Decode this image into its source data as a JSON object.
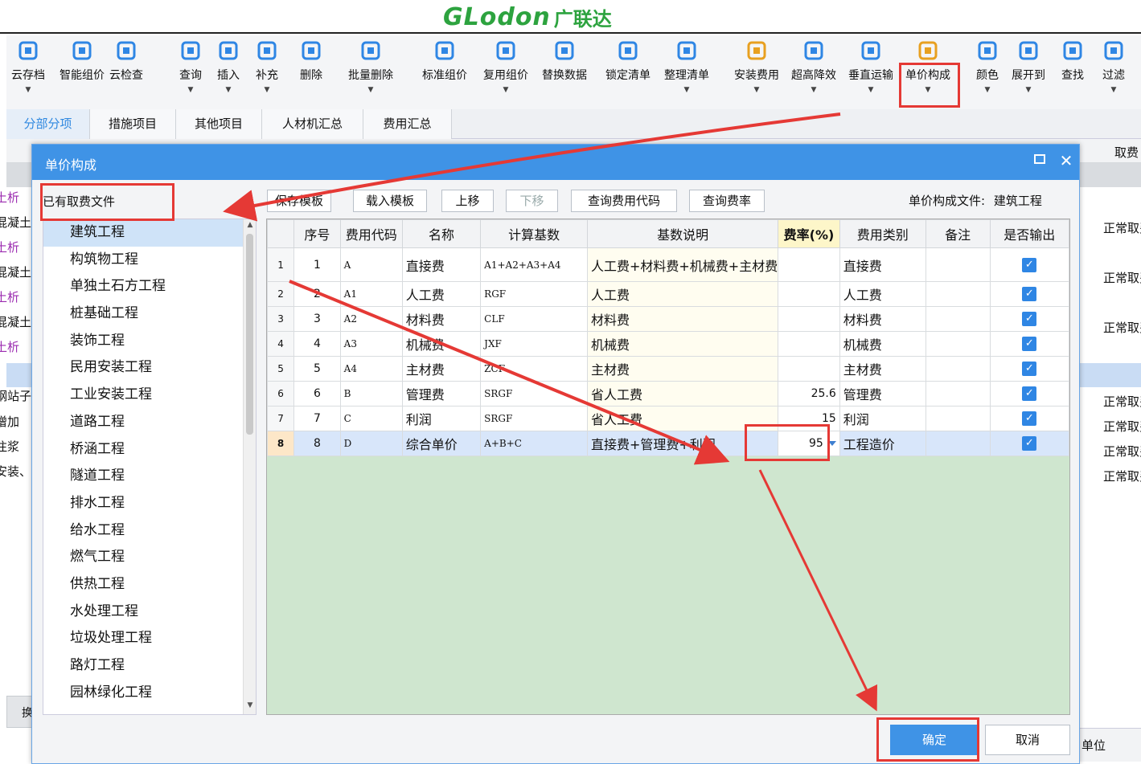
{
  "logo": {
    "en": "GLodon",
    "cn": "广联达"
  },
  "toolbar": [
    {
      "label": "云存档",
      "icon": "cloud-save-icon",
      "arrow": true
    },
    {
      "label": "智能组价",
      "icon": "smart-price-icon",
      "arrow": false
    },
    {
      "label": "云检查",
      "icon": "cloud-check-icon",
      "arrow": false
    },
    {
      "label": "查询",
      "icon": "query-icon",
      "arrow": true
    },
    {
      "label": "插入",
      "icon": "insert-icon",
      "arrow": true
    },
    {
      "label": "补充",
      "icon": "supplement-icon",
      "arrow": true
    },
    {
      "label": "删除",
      "icon": "delete-icon",
      "arrow": false
    },
    {
      "label": "批量删除",
      "icon": "batch-delete-icon",
      "arrow": true
    },
    {
      "label": "标准组价",
      "icon": "standard-price-icon",
      "arrow": false
    },
    {
      "label": "复用组价",
      "icon": "reuse-price-icon",
      "arrow": true
    },
    {
      "label": "替换数据",
      "icon": "replace-data-icon",
      "arrow": false
    },
    {
      "label": "锁定清单",
      "icon": "lock-list-icon",
      "arrow": false
    },
    {
      "label": "整理清单",
      "icon": "organize-list-icon",
      "arrow": true
    },
    {
      "label": "安装费用",
      "icon": "install-cost-icon",
      "arrow": true
    },
    {
      "label": "超高降效",
      "icon": "high-rise-icon",
      "arrow": true
    },
    {
      "label": "垂直运输",
      "icon": "vertical-transport-icon",
      "arrow": true
    },
    {
      "label": "单价构成",
      "icon": "unit-price-icon",
      "arrow": true
    },
    {
      "label": "颜色",
      "icon": "color-icon",
      "arrow": true
    },
    {
      "label": "展开到",
      "icon": "expand-to-icon",
      "arrow": true
    },
    {
      "label": "查找",
      "icon": "find-icon",
      "arrow": false
    },
    {
      "label": "过滤",
      "icon": "filter-icon",
      "arrow": true
    }
  ],
  "tabs": [
    "分部分项",
    "措施项目",
    "其他项目",
    "人材机汇总",
    "费用汇总"
  ],
  "background": {
    "left_rows": [
      "土析",
      "混凝土",
      "土析",
      "混凝土",
      "土析",
      "混凝土",
      "土析",
      "钢站子",
      "增加",
      "注浆",
      "安装、"
    ],
    "right_header": "取费",
    "right_rows": [
      "正常取费",
      "正常取费",
      "正常取费",
      "正常取费",
      "正常取费",
      "正常取费",
      "正常取费"
    ],
    "bottom_unit": "单位",
    "bottom_left": "换"
  },
  "dialog": {
    "title": "单价构成",
    "left_header": "已有取费文件",
    "files": [
      "建筑工程",
      "构筑物工程",
      "单独土石方工程",
      "桩基础工程",
      "装饰工程",
      "民用安装工程",
      "工业安装工程",
      "道路工程",
      "桥涵工程",
      "隧道工程",
      "排水工程",
      "给水工程",
      "燃气工程",
      "供热工程",
      "水处理工程",
      "垃圾处理工程",
      "路灯工程",
      "园林绿化工程"
    ],
    "buttons": [
      "保存模板",
      "载入模板",
      "上移",
      "下移",
      "查询费用代码",
      "查询费率"
    ],
    "file_info_label": "单价构成文件:",
    "file_info_value": "建筑工程",
    "columns": [
      "序号",
      "费用代码",
      "名称",
      "计算基数",
      "基数说明",
      "费率(%)",
      "费用类别",
      "备注",
      "是否输出"
    ],
    "rows": [
      {
        "no": "1",
        "seq": "1",
        "code": "A",
        "name": "直接费",
        "base": "A1+A2+A3+A4",
        "desc": "人工费+材料费+机械费+主材费",
        "rate": "",
        "type": "直接费",
        "note": "",
        "output": true
      },
      {
        "no": "2",
        "seq": "2",
        "code": "A1",
        "name": "人工费",
        "base": "RGF",
        "desc": "人工费",
        "rate": "",
        "type": "人工费",
        "note": "",
        "output": true
      },
      {
        "no": "3",
        "seq": "3",
        "code": "A2",
        "name": "材料费",
        "base": "CLF",
        "desc": "材料费",
        "rate": "",
        "type": "材料费",
        "note": "",
        "output": true
      },
      {
        "no": "4",
        "seq": "4",
        "code": "A3",
        "name": "机械费",
        "base": "JXF",
        "desc": "机械费",
        "rate": "",
        "type": "机械费",
        "note": "",
        "output": true
      },
      {
        "no": "5",
        "seq": "5",
        "code": "A4",
        "name": "主材费",
        "base": "ZCF",
        "desc": "主材费",
        "rate": "",
        "type": "主材费",
        "note": "",
        "output": true
      },
      {
        "no": "6",
        "seq": "6",
        "code": "B",
        "name": "管理费",
        "base": "SRGF",
        "desc": "省人工费",
        "rate": "25.6",
        "type": "管理费",
        "note": "",
        "output": true
      },
      {
        "no": "7",
        "seq": "7",
        "code": "C",
        "name": "利润",
        "base": "SRGF",
        "desc": "省人工费",
        "rate": "15",
        "type": "利润",
        "note": "",
        "output": true
      },
      {
        "no": "8",
        "seq": "8",
        "code": "D",
        "name": "综合单价",
        "base": "A+B+C",
        "desc": "直接费+管理费+利润",
        "rate": "95",
        "type": "工程造价",
        "note": "",
        "output": true
      }
    ],
    "selected_row": 8,
    "ok": "确定",
    "cancel": "取消"
  },
  "colors": {
    "accent": "#3f93e6",
    "annotation": "#e53935",
    "grid_empty": "#cfe6cf",
    "logo": "#2da33f"
  }
}
